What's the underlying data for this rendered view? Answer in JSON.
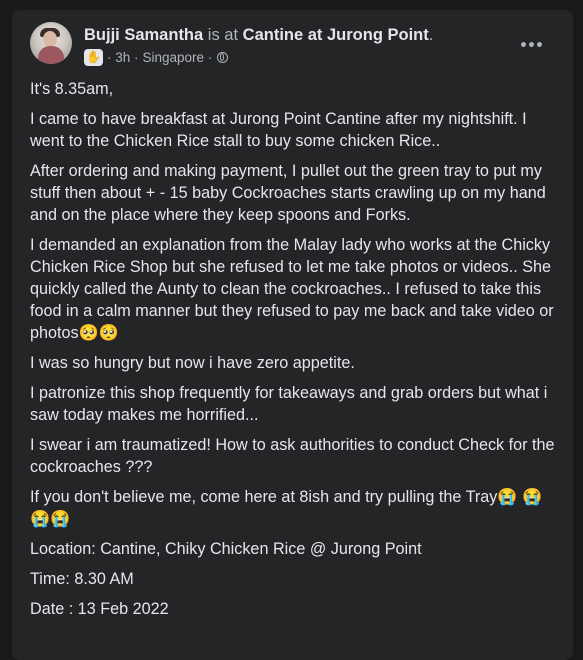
{
  "post": {
    "author": "Bujji Samantha",
    "is_at": "is at",
    "location": "Cantine at Jurong Point",
    "period": ".",
    "time_ago": "· 3h ·",
    "place": "Singapore ·",
    "badge_icon": "waving-hand-icon",
    "privacy_icon": "globe-icon",
    "more_icon": "more-options-icon",
    "paragraphs": [
      "It's 8.35am,",
      "I came to have breakfast at Jurong Point Cantine after my nightshift. I went to the Chicken Rice stall to buy some chicken Rice..",
      "After ordering and making payment, I pullet out the green tray to put my stuff then about + - 15 baby Cockroaches starts crawling up on my hand and on the place where they keep spoons and Forks.",
      "I demanded an explanation from the Malay lady who works at the Chicky Chicken Rice Shop but she refused to let me take photos or videos.. She quickly called the Aunty to clean the cockroaches.. I refused to take this food in a calm manner but they refused to pay me back and take video or photos🥺🥺",
      "I was so hungry but now i have zero appetite.",
      "I patronize this shop frequently for takeaways and grab orders but what i saw today makes me horrified...",
      "I swear i am traumatized! How to ask authorities to conduct Check for the cockroaches ???",
      "If you don't believe me, come here at 8ish and try pulling the Tray😭 😭😭😭",
      "Location: Cantine, Chiky Chicken Rice @ Jurong Point",
      "Time: 8.30 AM",
      "Date : 13 Feb 2022"
    ]
  }
}
